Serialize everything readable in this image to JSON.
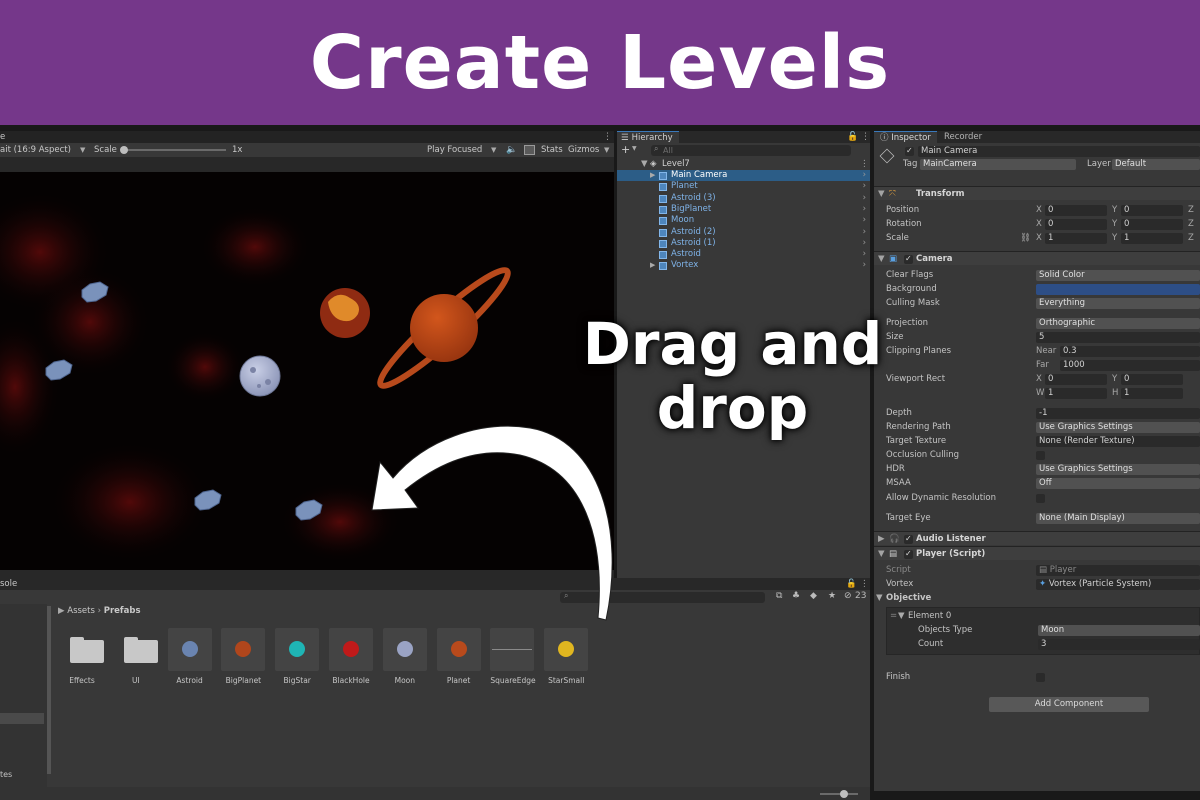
{
  "banner": {
    "title": "Create Levels",
    "color": "#75378a"
  },
  "overlay": {
    "line1": "Drag and",
    "line2": "drop"
  },
  "game": {
    "tab_fragment": "e",
    "aspect": "ait (16:9 Aspect)",
    "scale_label": "Scale",
    "scale_value": "1x",
    "play_mode": "Play Focused",
    "stats": "Stats",
    "gizmos": "Gizmos"
  },
  "hierarchy": {
    "tab": "Hierarchy",
    "search_placeholder": "All",
    "scene": "Level7",
    "items": [
      {
        "label": "Main Camera",
        "selected": true
      },
      {
        "label": "Planet"
      },
      {
        "label": "Astroid (3)"
      },
      {
        "label": "BigPlanet"
      },
      {
        "label": "Moon"
      },
      {
        "label": "Astroid (2)"
      },
      {
        "label": "Astroid (1)"
      },
      {
        "label": "Astroid"
      },
      {
        "label": "Vortex"
      }
    ]
  },
  "inspector": {
    "tabs": [
      "Inspector",
      "Recorder"
    ],
    "object_name": "Main Camera",
    "tag_label": "Tag",
    "tag_value": "MainCamera",
    "layer_label": "Layer",
    "layer_value": "Default",
    "transform": {
      "title": "Transform",
      "position_label": "Position",
      "rotation_label": "Rotation",
      "scale_label": "Scale",
      "position": [
        "0",
        "0"
      ],
      "rotation": [
        "0",
        "0"
      ],
      "scale": [
        "1",
        "1"
      ],
      "axis_x": "X",
      "axis_y": "Y",
      "axis_z": "Z"
    },
    "camera": {
      "title": "Camera",
      "clear_flags_label": "Clear Flags",
      "clear_flags": "Solid Color",
      "background_label": "Background",
      "background_color": "#2d4e86",
      "culling_mask_label": "Culling Mask",
      "culling_mask": "Everything",
      "projection_label": "Projection",
      "projection": "Orthographic",
      "size_label": "Size",
      "size": "5",
      "clipping_label": "Clipping Planes",
      "near_label": "Near",
      "near": "0.3",
      "far_label": "Far",
      "far": "1000",
      "viewport_label": "Viewport Rect",
      "vp_x_label": "X",
      "vp_x": "0",
      "vp_y_label": "Y",
      "vp_y": "0",
      "vp_w_label": "W",
      "vp_w": "1",
      "vp_h_label": "H",
      "vp_h": "1",
      "depth_label": "Depth",
      "depth": "-1",
      "rendering_path_label": "Rendering Path",
      "rendering_path": "Use Graphics Settings",
      "target_texture_label": "Target Texture",
      "target_texture": "None (Render Texture)",
      "occlusion_label": "Occlusion Culling",
      "hdr_label": "HDR",
      "hdr": "Use Graphics Settings",
      "msaa_label": "MSAA",
      "msaa": "Off",
      "dynamic_res_label": "Allow Dynamic Resolution",
      "target_eye_label": "Target Eye",
      "target_eye": "None (Main Display)"
    },
    "audio_listener": {
      "title": "Audio Listener"
    },
    "player_script": {
      "title": "Player (Script)",
      "script_label": "Script",
      "script": "Player",
      "vortex_label": "Vortex",
      "vortex": "Vortex (Particle System)",
      "objective_label": "Objective",
      "element_label": "Element 0",
      "objects_type_label": "Objects Type",
      "objects_type": "Moon",
      "count_label": "Count",
      "count": "3",
      "finish_label": "Finish"
    },
    "add_component": "Add Component"
  },
  "project": {
    "tab_fragment": "sole",
    "breadcrumb_root": "Assets",
    "breadcrumb_folder": "Prefabs",
    "hidden_count": "23",
    "left_fragment": "tes",
    "assets": [
      {
        "name": "Effects",
        "kind": "folder"
      },
      {
        "name": "UI",
        "kind": "folder"
      },
      {
        "name": "Astroid",
        "kind": "prefab",
        "color": "#6a84b0"
      },
      {
        "name": "BigPlanet",
        "kind": "prefab",
        "color": "#b0461c"
      },
      {
        "name": "BigStar",
        "kind": "prefab",
        "color": "#1fb5b5"
      },
      {
        "name": "BlackHole",
        "kind": "prefab",
        "color": "#c01a1a"
      },
      {
        "name": "Moon",
        "kind": "prefab",
        "color": "#9aa3c4"
      },
      {
        "name": "Planet",
        "kind": "prefab",
        "color": "#b84a1c"
      },
      {
        "name": "SquareEdge",
        "kind": "prefab",
        "color": "#8a8a8a"
      },
      {
        "name": "StarSmall",
        "kind": "prefab",
        "color": "#e0b620"
      }
    ]
  }
}
